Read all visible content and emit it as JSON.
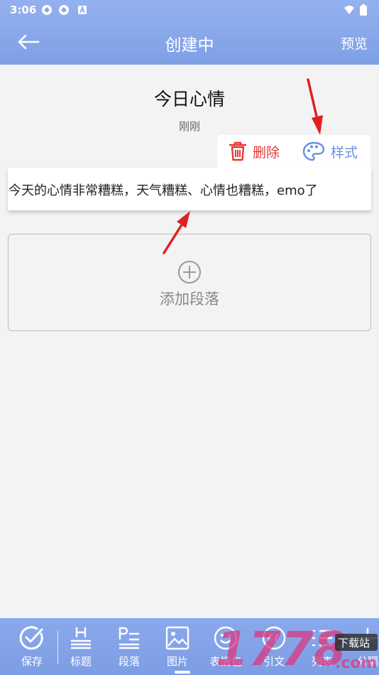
{
  "status_bar": {
    "time": "3:06"
  },
  "app_bar": {
    "title": "创建中",
    "preview_label": "预览"
  },
  "document": {
    "title": "今日心情",
    "timestamp": "刚刚"
  },
  "paragraph_actions": {
    "delete_label": "删除",
    "style_label": "样式"
  },
  "paragraph": {
    "text": "今天的心情非常糟糕，天气糟糕、心情也糟糕，emo了"
  },
  "add_paragraph": {
    "label": "添加段落"
  },
  "toolbar": {
    "items": [
      {
        "label": "保存",
        "icon": "check-circle-icon"
      },
      {
        "label": "标题",
        "icon": "heading-icon"
      },
      {
        "label": "段落",
        "icon": "paragraph-icon"
      },
      {
        "label": "图片",
        "icon": "image-icon"
      },
      {
        "label": "表情包",
        "icon": "emoji-icon"
      },
      {
        "label": "引文",
        "icon": "quote-icon"
      },
      {
        "label": "列表",
        "icon": "list-icon"
      },
      {
        "label": "分隔",
        "icon": "divider-icon"
      }
    ]
  },
  "watermark": {
    "brand": "1778",
    "caption": "下载站",
    "suffix": ".com"
  },
  "colors": {
    "header": "#86a5ea",
    "delete": "#e53935",
    "style": "#6c8fe0",
    "annotation_arrow": "#e02020"
  }
}
